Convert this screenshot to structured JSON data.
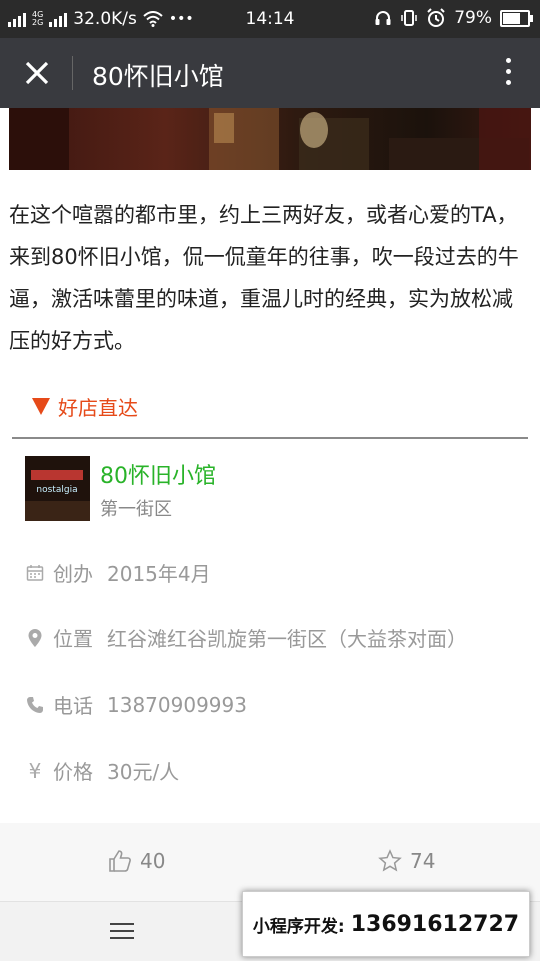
{
  "status_bar": {
    "network_left": "2G",
    "network_left2": "4G",
    "network_left3": "2G",
    "speed": "32.0K/s",
    "dots": "•••",
    "time": "14:14",
    "battery_percent": "79%",
    "battery_level": 0.79
  },
  "titlebar": {
    "title": "80怀旧小馆"
  },
  "article": {
    "paragraph": "在这个喧嚣的都市里，约上三两好友，或者心爱的TA，来到80怀旧小馆，侃一侃童年的往事，吹一段过去的牛逼，激活味蕾里的味道，重温儿时的经典，实为放松减压的好方式。"
  },
  "section": {
    "title": "好店直达"
  },
  "shop": {
    "name": "80怀旧小馆",
    "district": "第一街区",
    "thumb_text": "nostalgia"
  },
  "info": {
    "founded_label": "创办",
    "founded_value": "2015年4月",
    "location_label": "位置",
    "location_value": "红谷滩红谷凯旋第一街区（大益茶对面）",
    "phone_label": "电话",
    "phone_value": "13870909993",
    "price_label": "价格",
    "price_value": "30元/人"
  },
  "actions": {
    "likes": "40",
    "stars": "74"
  },
  "ad": {
    "label": "小程序开发:",
    "phone": "13691612727"
  },
  "colors": {
    "accent_red": "#e64a19",
    "shop_green": "#29b329",
    "titlebar_bg": "#393a3f"
  }
}
